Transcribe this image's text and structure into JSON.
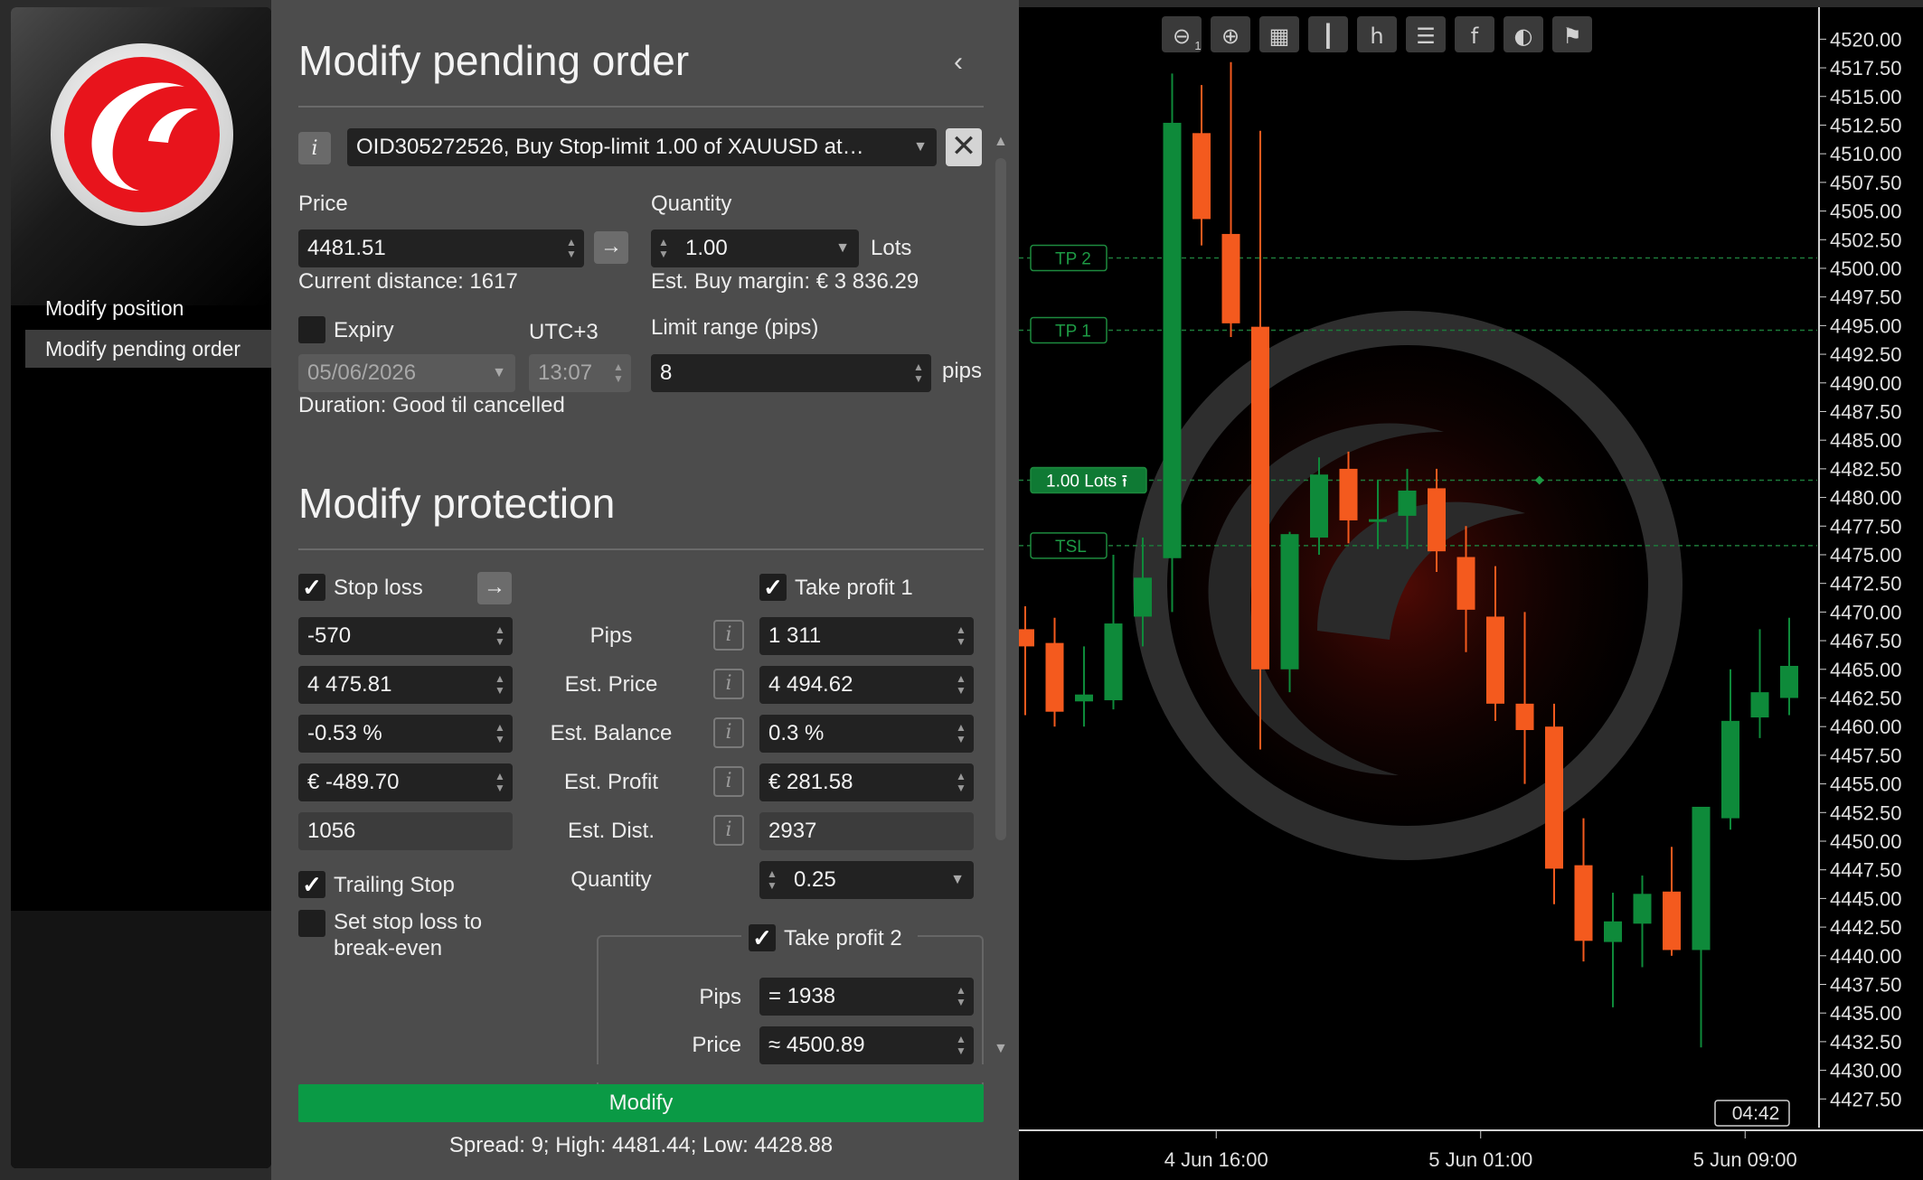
{
  "nav": {
    "items": [
      {
        "label": "Modify position"
      },
      {
        "label": "Modify pending order"
      }
    ]
  },
  "form": {
    "title": "Modify pending order",
    "order_select": "OID305272526, Buy Stop-limit 1.00 of XAUUSD at…",
    "price_label": "Price",
    "price_value": "4481.51",
    "current_distance": "Current distance: 1617",
    "quantity_label": "Quantity",
    "quantity_value": "1.00",
    "lots_label": "Lots",
    "est_margin": "Est. Buy margin: € 3 836.29",
    "expiry_label": "Expiry",
    "timezone": "UTC+3",
    "expiry_date": "05/06/2026",
    "expiry_time": "13:07",
    "duration": "Duration: Good til cancelled",
    "limit_range_label": "Limit range (pips)",
    "limit_range_value": "8",
    "pips_unit": "pips"
  },
  "protection": {
    "title": "Modify protection",
    "stop_loss_label": "Stop loss",
    "take_profit1_label": "Take profit 1",
    "rows": [
      {
        "label": "Pips",
        "sl": "-570",
        "tp": "1 311"
      },
      {
        "label": "Est. Price",
        "sl": "4 475.81",
        "tp": "4 494.62"
      },
      {
        "label": "Est. Balance",
        "sl": "-0.53 %",
        "tp": "0.3 %"
      },
      {
        "label": "Est. Profit",
        "sl": "€ -489.70",
        "tp": "€ 281.58"
      },
      {
        "label": "Est. Dist.",
        "sl": "1056",
        "tp": "2937"
      }
    ],
    "quantity_label": "Quantity",
    "quantity_value": "0.25",
    "trailing_stop_label": "Trailing Stop",
    "breakeven_label_1": "Set stop loss to",
    "breakeven_label_2": "break-even",
    "take_profit2_label": "Take profit 2",
    "tp2_pips_label": "Pips",
    "tp2_pips_value": "= 1938",
    "tp2_price_label": "Price",
    "tp2_price_value": "≈ 4500.89"
  },
  "footer": {
    "modify_label": "Modify",
    "spread": "Spread: 9; High: 4481.44; Low: 4428.88"
  },
  "colors": {
    "bull": "#0e8a3a",
    "bear": "#f45a1e",
    "accent_green": "#0a9a45",
    "logo_red": "#e8141c"
  },
  "chart_data": {
    "type": "candlestick",
    "symbol_hint": "XAUUSD",
    "ylim": [
      4425.0,
      4522.0
    ],
    "yticks": [
      "4520.00",
      "4517.50",
      "4515.00",
      "4512.50",
      "4510.00",
      "4507.50",
      "4505.00",
      "4502.50",
      "4500.00",
      "4497.50",
      "4495.00",
      "4492.50",
      "4490.00",
      "4487.50",
      "4485.00",
      "4482.50",
      "4480.00",
      "4477.50",
      "4475.00",
      "4472.50",
      "4470.00",
      "4467.50",
      "4465.00",
      "4462.50",
      "4460.00",
      "4457.50",
      "4455.00",
      "4452.50",
      "4450.00",
      "4447.50",
      "4445.00",
      "4442.50",
      "4440.00",
      "4437.50",
      "4435.00",
      "4432.50",
      "4430.00",
      "4427.50"
    ],
    "xticks": [
      {
        "label": "4 Jun 16:00",
        "index": 6.5
      },
      {
        "label": "5 Jun 01:00",
        "index": 15.5
      },
      {
        "label": "5 Jun 09:00",
        "index": 24.5
      }
    ],
    "candles": [
      {
        "o": 4468.5,
        "h": 4470.5,
        "l": 4461.0,
        "c": 4467.0
      },
      {
        "o": 4467.3,
        "h": 4469.5,
        "l": 4460.0,
        "c": 4461.3
      },
      {
        "o": 4462.2,
        "h": 4467.0,
        "l": 4460.0,
        "c": 4462.8
      },
      {
        "o": 4462.3,
        "h": 4475.0,
        "l": 4461.5,
        "c": 4469.0
      },
      {
        "o": 4469.6,
        "h": 4476.5,
        "l": 4467.0,
        "c": 4473.0
      },
      {
        "o": 4474.7,
        "h": 4517.0,
        "l": 4470.0,
        "c": 4512.7
      },
      {
        "o": 4511.8,
        "h": 4516.0,
        "l": 4502.0,
        "c": 4504.3
      },
      {
        "o": 4503.0,
        "h": 4518.0,
        "l": 4494.0,
        "c": 4495.2
      },
      {
        "o": 4494.9,
        "h": 4512.0,
        "l": 4458.0,
        "c": 4465.0
      },
      {
        "o": 4465.0,
        "h": 4477.0,
        "l": 4463.0,
        "c": 4476.8
      },
      {
        "o": 4476.5,
        "h": 4483.5,
        "l": 4475.0,
        "c": 4482.0
      },
      {
        "o": 4482.5,
        "h": 4484.0,
        "l": 4476.0,
        "c": 4478.0
      },
      {
        "o": 4478.0,
        "h": 4481.5,
        "l": 4475.5,
        "c": 4478.1
      },
      {
        "o": 4478.4,
        "h": 4482.5,
        "l": 4475.5,
        "c": 4480.6
      },
      {
        "o": 4480.8,
        "h": 4482.5,
        "l": 4473.5,
        "c": 4475.3
      },
      {
        "o": 4474.8,
        "h": 4477.5,
        "l": 4466.5,
        "c": 4470.2
      },
      {
        "o": 4469.6,
        "h": 4474.0,
        "l": 4460.5,
        "c": 4462.0
      },
      {
        "o": 4462.0,
        "h": 4470.0,
        "l": 4455.0,
        "c": 4459.7
      },
      {
        "o": 4460.0,
        "h": 4462.0,
        "l": 4444.5,
        "c": 4447.6
      },
      {
        "o": 4447.9,
        "h": 4452.0,
        "l": 4439.5,
        "c": 4441.3
      },
      {
        "o": 4441.2,
        "h": 4445.5,
        "l": 4435.5,
        "c": 4443.0
      },
      {
        "o": 4442.8,
        "h": 4447.0,
        "l": 4439.0,
        "c": 4445.4
      },
      {
        "o": 4445.6,
        "h": 4449.5,
        "l": 4440.0,
        "c": 4440.5
      },
      {
        "o": 4440.5,
        "h": 4453.0,
        "l": 4432.0,
        "c": 4453.0
      },
      {
        "o": 4452.0,
        "h": 4465.0,
        "l": 4451.0,
        "c": 4460.5
      },
      {
        "o": 4460.8,
        "h": 4468.5,
        "l": 4459.0,
        "c": 4463.0
      },
      {
        "o": 4462.5,
        "h": 4469.5,
        "l": 4461.0,
        "c": 4465.3
      }
    ],
    "levels": [
      {
        "label": "TP 2",
        "price": 4500.9
      },
      {
        "label": "TP 1",
        "price": 4494.6
      },
      {
        "label": "1.00 Lots",
        "price": 4481.5
      },
      {
        "label": "TSL",
        "price": 4475.8
      }
    ],
    "time_label": "04:42",
    "toolbar_icons": [
      "zoom-out-icon",
      "zoom-in-icon",
      "chart-settings-icon",
      "candles-icon",
      "timeframe-icon",
      "list-icon",
      "facebook-icon",
      "theme-icon",
      "trader-icon"
    ],
    "timeframe": "h",
    "timeframe_sub": "1"
  }
}
